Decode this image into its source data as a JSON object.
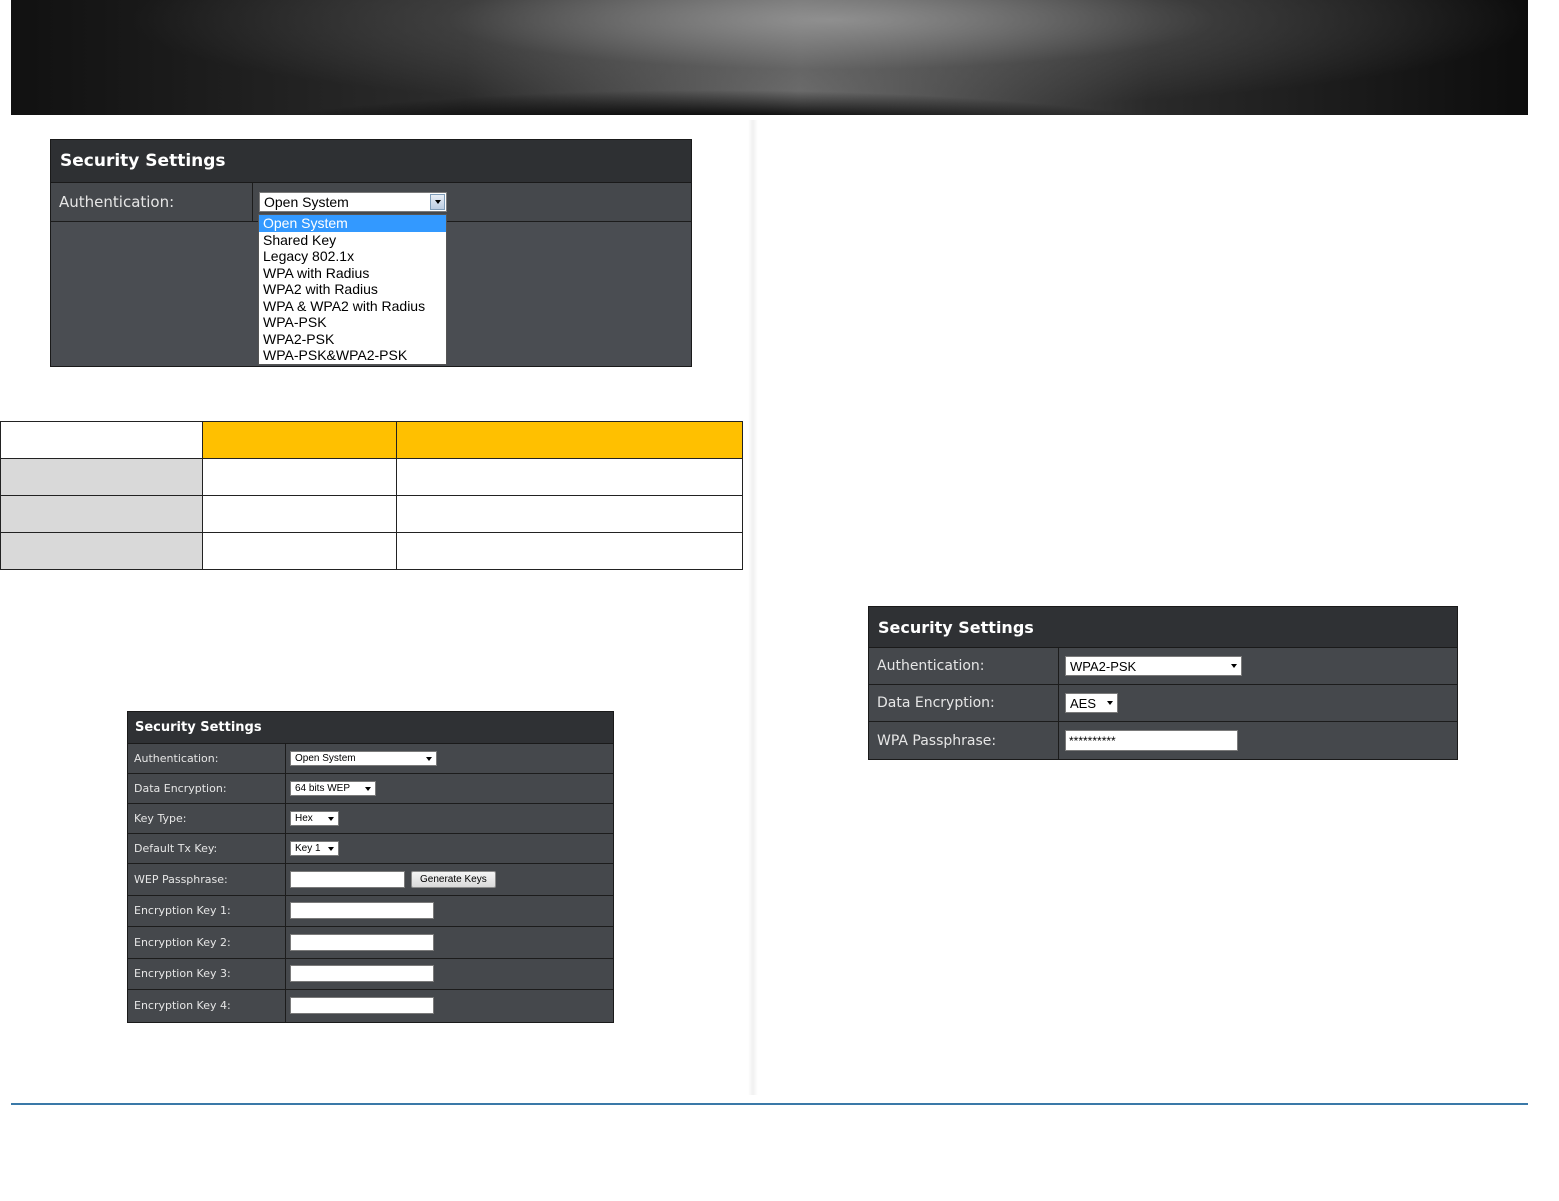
{
  "panel1": {
    "title": "Security Settings",
    "authentication_label": "Authentication:",
    "authentication_value": "Open System",
    "dropdown_options": [
      "Open System",
      "Shared Key",
      "Legacy 802.1x",
      "WPA with Radius",
      "WPA2 with Radius",
      "WPA & WPA2 with Radius",
      "WPA-PSK",
      "WPA2-PSK",
      "WPA-PSK&WPA2-PSK"
    ],
    "selected_option": "Open System"
  },
  "panel2": {
    "title": "Security Settings",
    "authentication_label": "Authentication:",
    "authentication_value": "Open System",
    "data_encryption_label": "Data Encryption:",
    "data_encryption_value": "64 bits WEP",
    "key_type_label": "Key Type:",
    "key_type_value": "Hex",
    "default_tx_key_label": "Default Tx Key:",
    "default_tx_key_value": "Key 1",
    "wep_passphrase_label": "WEP Passphrase:",
    "generate_keys_label": "Generate Keys",
    "encryption_key_labels": [
      "Encryption Key 1:",
      "Encryption Key 2:",
      "Encryption Key 3:",
      "Encryption Key 4:"
    ]
  },
  "panel3": {
    "title": "Security Settings",
    "authentication_label": "Authentication:",
    "authentication_value": "WPA2-PSK",
    "data_encryption_label": "Data Encryption:",
    "data_encryption_value": "AES",
    "wpa_passphrase_label": "WPA Passphrase:",
    "wpa_passphrase_value": "**********"
  },
  "colors": {
    "table_header": "#ffc000",
    "table_first_col": "#d9d9d9",
    "footer_line": "#3a79a8",
    "dropdown_highlight": "#3399ff"
  }
}
